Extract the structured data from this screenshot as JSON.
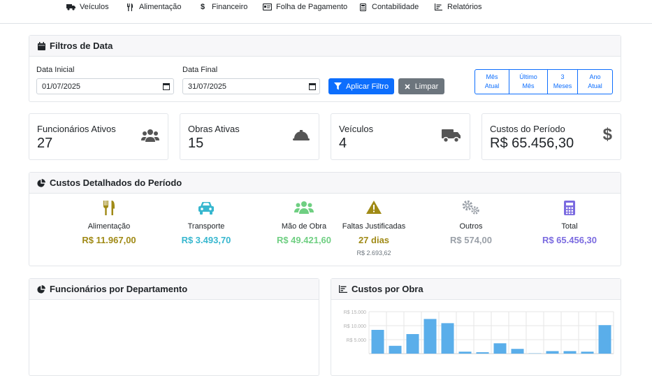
{
  "nav": {
    "items": [
      {
        "label": "Veículos",
        "icon": "truck-icon"
      },
      {
        "label": "Alimentação",
        "icon": "utensils-icon"
      },
      {
        "label": "Financeiro",
        "icon": "dollar-icon"
      },
      {
        "label": "Folha de Pagamento",
        "icon": "id-card-icon"
      },
      {
        "label": "Contabilidade",
        "icon": "calculator-icon"
      },
      {
        "label": "Relatórios",
        "icon": "chart-bar-icon"
      }
    ]
  },
  "filters": {
    "title": "Filtros de Data",
    "start_label": "Data Inicial",
    "start_value": "01/07/2025",
    "end_label": "Data Final",
    "end_value": "31/07/2025",
    "apply_label": "Aplicar Filtro",
    "clear_label": "Limpar",
    "quick": [
      {
        "line1": "Mês",
        "line2": "Atual"
      },
      {
        "line1": "Último",
        "line2": "Mês"
      },
      {
        "line1": "3",
        "line2": "Meses"
      },
      {
        "line1": "Ano",
        "line2": "Atual"
      }
    ]
  },
  "stats": [
    {
      "title": "Funcionários Ativos",
      "value": "27",
      "icon": "users-icon"
    },
    {
      "title": "Obras Ativas",
      "value": "15",
      "icon": "hard-hat-icon"
    },
    {
      "title": "Veículos",
      "value": "4",
      "icon": "truck-icon"
    },
    {
      "title": "Custos do Período",
      "value": "R$ 65.456,30",
      "icon": "dollar-icon"
    }
  ],
  "costs": {
    "title": "Custos Detalhados do Período",
    "items": [
      {
        "label": "Alimentação",
        "value": "R$ 11.967,00",
        "sub": "",
        "color": "#a08a16",
        "icon": "utensils-icon"
      },
      {
        "label": "Transporte",
        "value": "R$ 3.493,70",
        "sub": "",
        "color": "#37b7cf",
        "icon": "car-icon"
      },
      {
        "label": "Mão de Obra",
        "value": "R$ 49.421,60",
        "sub": "",
        "color": "#6fcf82",
        "icon": "users-icon"
      },
      {
        "label": "Faltas Justificadas",
        "value": "27 dias",
        "sub": "R$ 2.693,62",
        "color": "#a08a16",
        "icon": "warning-icon"
      },
      {
        "label": "Outros",
        "value": "R$ 574,00",
        "sub": "",
        "color": "#9aa0a8",
        "icon": "cogs-icon"
      },
      {
        "label": "Total",
        "value": "R$ 65.456,30",
        "sub": "",
        "color": "#7b6be0",
        "icon": "calculator-icon"
      }
    ]
  },
  "dept_panel": {
    "title": "Funcionários por Departamento"
  },
  "obra_panel": {
    "title": "Custos por Obra"
  },
  "chart_data": {
    "type": "bar",
    "title": "",
    "ylim": [
      0,
      15000
    ],
    "yticks": [
      "R$ 15.000",
      "R$ 10.000",
      "R$ 5.000"
    ],
    "values": [
      8500,
      2800,
      7000,
      12400,
      10900,
      700,
      500,
      3700,
      1700,
      100,
      900,
      900,
      700,
      10200
    ],
    "bar_color": "#5aaeea",
    "grid": true
  }
}
